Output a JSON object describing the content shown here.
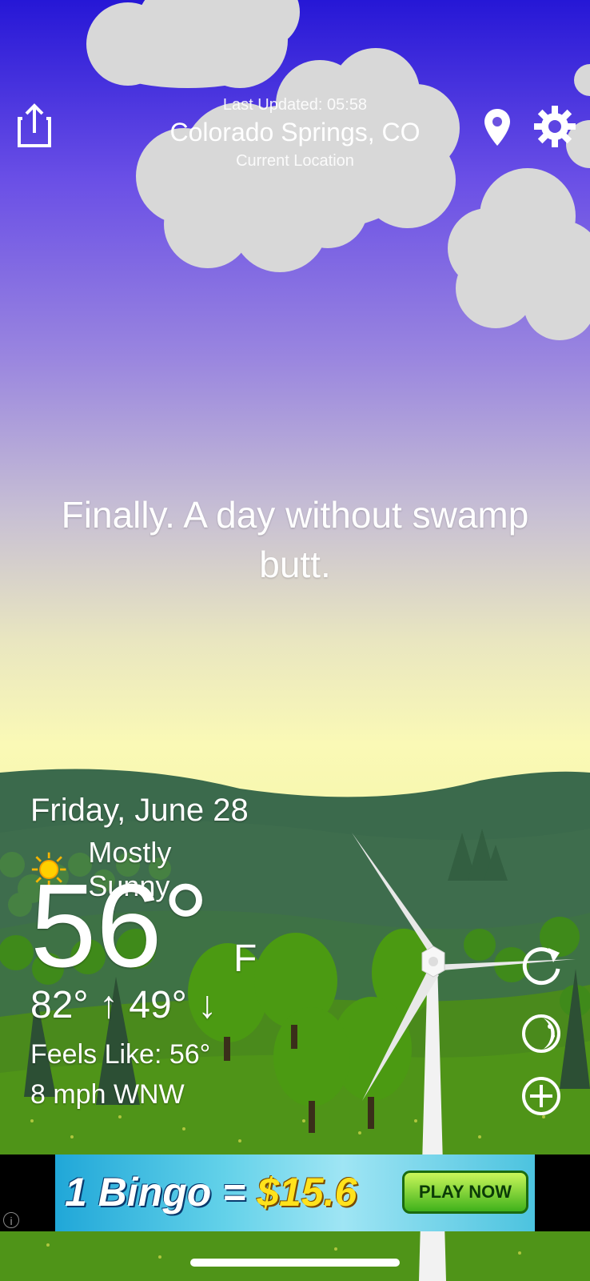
{
  "header": {
    "last_updated": "Last Updated: 05:58",
    "city": "Colorado Springs, CO",
    "location_label": "Current Location",
    "share_icon": "share-icon",
    "location_icon": "location-pin-icon",
    "settings_icon": "gear-icon"
  },
  "quote": "Finally. A day without swamp butt.",
  "weather": {
    "date": "Friday, June 28",
    "condition": "Mostly Sunny",
    "condition_icon": "sun-icon",
    "temperature": "56°",
    "unit": "F",
    "high": "82°",
    "low": "49°",
    "feels_like": "Feels Like: 56°",
    "wind": "8 mph WNW"
  },
  "side_buttons": [
    "refresh-icon",
    "moon-icon",
    "plus-circle-icon"
  ],
  "ad": {
    "text_prefix": "1 Bingo = ",
    "amount": "$15.6",
    "cta": "PLAY NOW",
    "info": "i"
  },
  "colors": {
    "sky_top": "#2617d6",
    "sky_horizon": "#faf9b6",
    "hills": "#3f6a4c",
    "grass": "#4c8f1a",
    "tree": "#4a9a12"
  }
}
